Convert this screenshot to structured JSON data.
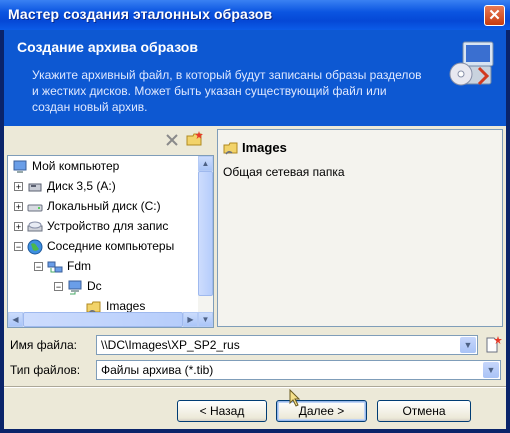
{
  "window": {
    "title": "Мастер создания эталонных образов",
    "close_glyph": "✕"
  },
  "header": {
    "title": "Создание архива образов",
    "description": "Укажите архивный файл, в который будут записаны образы разделов и жестких дисков. Может быть указан существующий файл или создан новый архив."
  },
  "tree": {
    "items": [
      {
        "label": "Мой компьютер",
        "icon": "computer-icon",
        "expander": ""
      },
      {
        "label": "Диск 3,5 (A:)",
        "icon": "floppy-icon",
        "expander": "+"
      },
      {
        "label": "Локальный диск (C:)",
        "icon": "harddisk-icon",
        "expander": "+"
      },
      {
        "label": "Устройство для запис",
        "icon": "cd-drive-icon",
        "expander": "+"
      },
      {
        "label": "Соседние компьютеры",
        "icon": "network-globe-icon",
        "expander": "−"
      },
      {
        "label": "Fdm",
        "icon": "network-group-icon",
        "expander": "−"
      },
      {
        "label": "Dc",
        "icon": "network-computer-icon",
        "expander": "−"
      },
      {
        "label": "Images",
        "icon": "shared-folder-icon",
        "expander": ""
      }
    ]
  },
  "info": {
    "title": "Images",
    "description": "Общая сетевая папка"
  },
  "filename": {
    "label": "Имя файла:",
    "value": "\\\\DC\\Images\\XP_SP2_rus"
  },
  "filetype": {
    "label": "Тип файлов:",
    "value": "Файлы архива (*.tib)"
  },
  "buttons": {
    "back": "< Назад",
    "next": "Далее >",
    "cancel": "Отмена"
  }
}
